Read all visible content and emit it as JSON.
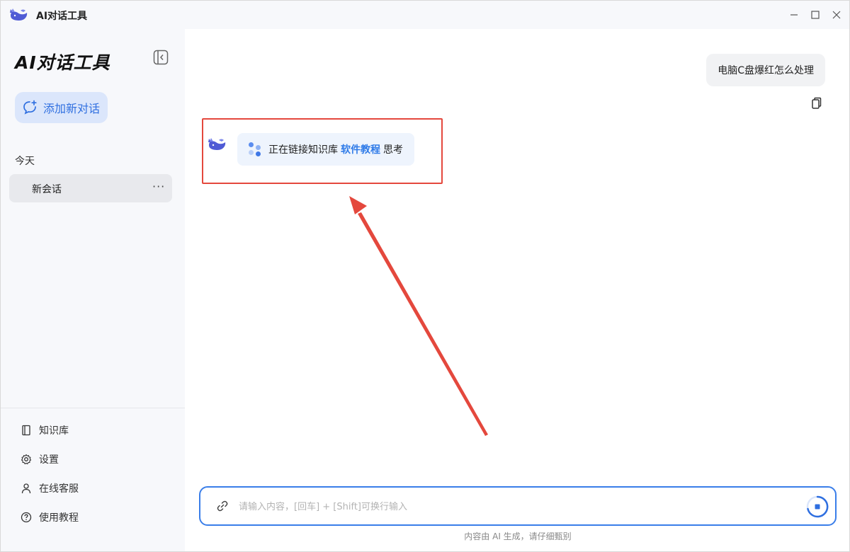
{
  "window": {
    "title": "AI对话工具"
  },
  "sidebar": {
    "title": "AI对话工具",
    "new_chat_label": "添加新对话",
    "group_label": "今天",
    "conversations": [
      {
        "label": "新会话",
        "more": "···"
      }
    ],
    "links": [
      {
        "label": "知识库",
        "icon": "book-icon"
      },
      {
        "label": "设置",
        "icon": "gear-icon"
      },
      {
        "label": "在线客服",
        "icon": "user-icon"
      },
      {
        "label": "使用教程",
        "icon": "help-icon"
      }
    ]
  },
  "chat": {
    "user_message": "电脑C盘爆红怎么处理",
    "bot_status_prefix": "正在链接知识库",
    "bot_status_kb": "软件教程",
    "bot_status_suffix": "思考"
  },
  "input": {
    "placeholder": "请输入内容，[回车] + [Shift]可换行输入",
    "value": ""
  },
  "footer_note": "内容由 AI 生成，请仔细甄别",
  "colors": {
    "accent": "#2f6fe0",
    "sidebar_bg": "#f7f8fb",
    "highlight": "#e4483d",
    "bot_bubble": "#eef4fd",
    "user_bubble": "#f1f2f4"
  }
}
